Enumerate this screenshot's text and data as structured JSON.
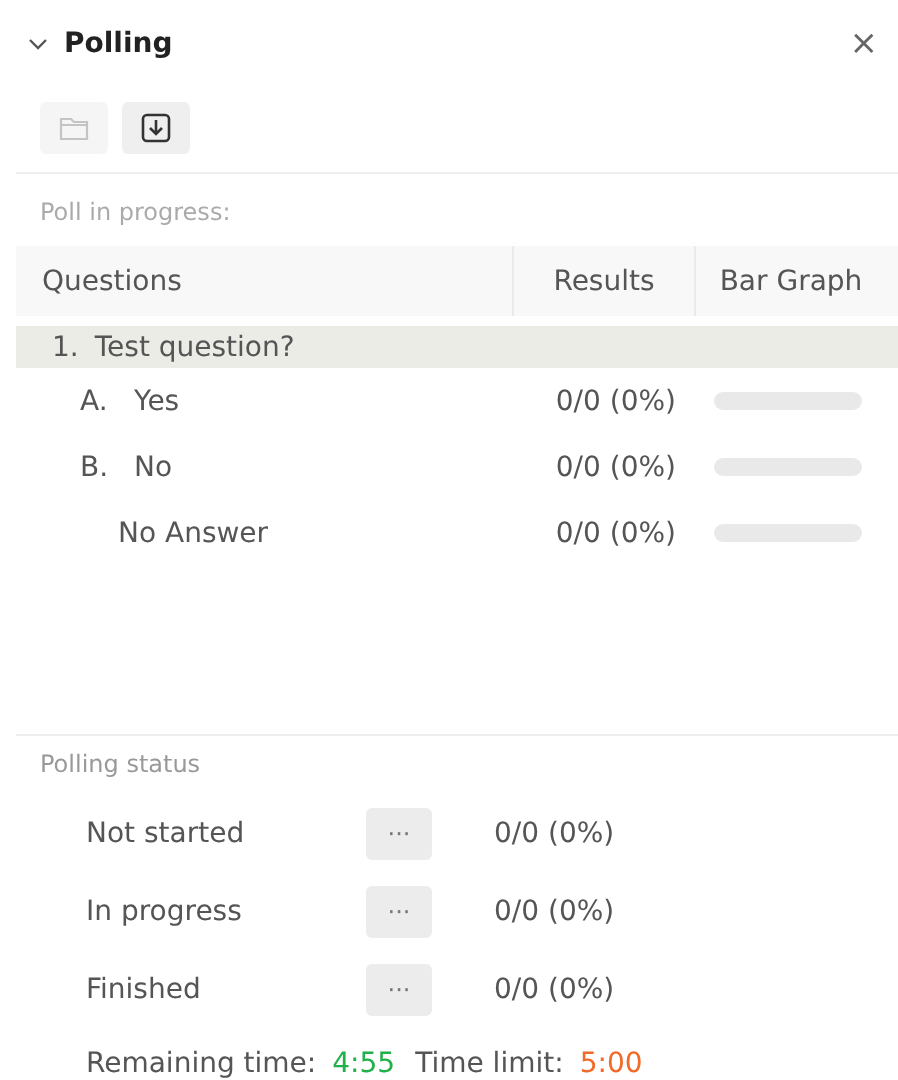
{
  "panel": {
    "title": "Polling",
    "expanded": true,
    "close": "×"
  },
  "toolbar": [
    {
      "kind": "folder",
      "disabled": true
    },
    {
      "kind": "download",
      "disabled": false
    }
  ],
  "poll_label": "Poll in progress:",
  "table": {
    "columns": [
      "Questions",
      "Results",
      "Bar Graph"
    ],
    "question": {
      "number": "1.",
      "text": "Test question?"
    },
    "answers": [
      {
        "letter": "A.",
        "text": "Yes",
        "result": "0/0 (0%)",
        "level": 0
      },
      {
        "letter": "B.",
        "text": "No",
        "result": "0/0 (0%)",
        "level": 0
      },
      {
        "text": "No Answer",
        "result": "0/0 (0%)",
        "level": 0
      }
    ]
  },
  "status": {
    "title": "Polling status",
    "rows": [
      {
        "label": "Not started",
        "more": "···",
        "result": "0/0 (0%)"
      },
      {
        "label": "In progress",
        "more": "···",
        "result": "0/0 (0%)"
      },
      {
        "label": "Finished",
        "more": "···",
        "result": "0/0 (0%)"
      }
    ]
  },
  "timer": {
    "remaining_label": "Remaining time:",
    "remaining": "4:55",
    "limit_label": "Time limit:",
    "limit": "5:00"
  }
}
